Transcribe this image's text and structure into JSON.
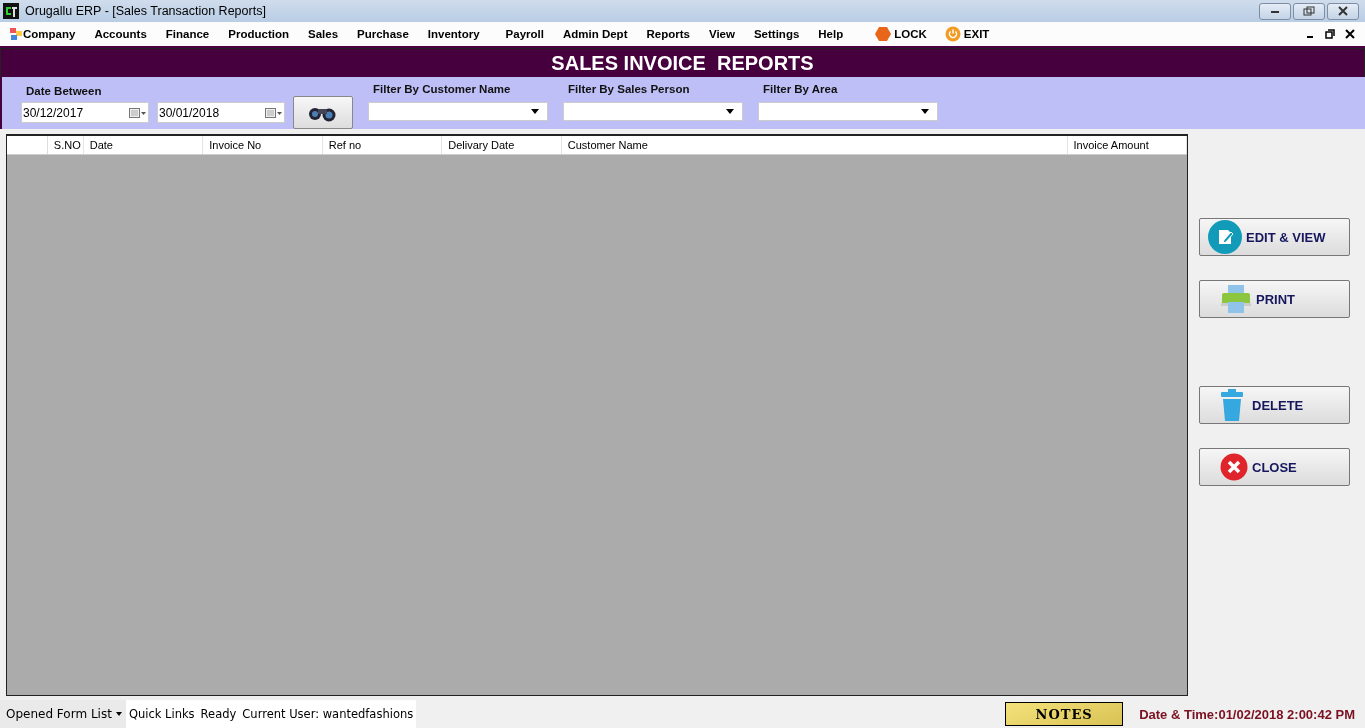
{
  "window": {
    "title": "Orugallu ERP - [Sales Transaction Reports]"
  },
  "menu": [
    "Company",
    "Accounts",
    "Finance",
    "Production",
    "Sales",
    "Purchase",
    "Inventory",
    "Payroll",
    "Admin Dept",
    "Reports",
    "View",
    "Settings",
    "Help"
  ],
  "menu_actions": [
    {
      "kind": "lock",
      "label": "LOCK"
    },
    {
      "kind": "exit",
      "label": "EXIT"
    }
  ],
  "header": "SALES INVOICE  REPORTS",
  "filters": {
    "date_label": "Date Between",
    "date_from": "30/12/2017",
    "date_to": "30/01/2018",
    "combos": [
      {
        "label": "Filter By Customer Name"
      },
      {
        "label": "Filter By Sales Person"
      },
      {
        "label": "Filter By Area"
      }
    ]
  },
  "table": {
    "columns": [
      "S.NO",
      "Date",
      "Invoice No",
      "Ref no",
      "Delivary Date",
      "Customer Name",
      "Invoice Amount"
    ]
  },
  "actions": [
    {
      "kind": "edit",
      "label": "EDIT & VIEW"
    },
    {
      "kind": "print",
      "label": "PRINT"
    },
    {
      "kind": "delete",
      "label": "DELETE"
    },
    {
      "kind": "close",
      "label": "CLOSE"
    }
  ],
  "status_bar": {
    "form_list": "Opened Form List",
    "quick_links": "Quick Links",
    "status": "Ready",
    "user": "Current User: wantedfashions",
    "notes": "NOTES",
    "datetime": "Date & Time:01/02/2018 2:00:42 PM"
  }
}
